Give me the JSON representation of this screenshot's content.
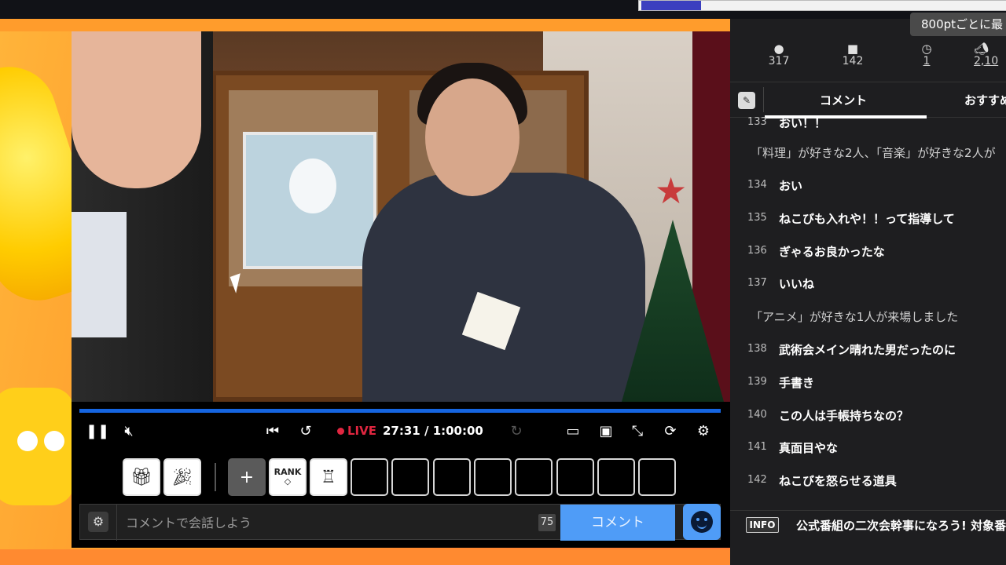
{
  "player": {
    "time_current": "27:31",
    "time_total": "1:00:00",
    "time_separator": " / ",
    "live_label": "LIVE",
    "progress": 1.0
  },
  "toolbar": {
    "rank_label": "RANK"
  },
  "comment_bar": {
    "placeholder": "コメントで会話しよう",
    "char_count": "75",
    "submit_label": "コメント"
  },
  "tooltip": "800ptごとに最",
  "stats": [
    {
      "icon": "viewers-icon",
      "value": "317"
    },
    {
      "icon": "comments-icon",
      "value": "142"
    },
    {
      "icon": "clock-icon",
      "value": "1"
    },
    {
      "icon": "ad-icon",
      "value": "2,10"
    }
  ],
  "tabs": {
    "comments": "コメント",
    "recommended": "おすすめ"
  },
  "comments": [
    {
      "num": "133",
      "text": "おい！！"
    },
    {
      "num": "",
      "text": "「料理」が好きな2人、「音楽」が好きな2人が"
    },
    {
      "num": "134",
      "text": "おい"
    },
    {
      "num": "135",
      "text": "ねこびも入れや！！って指導して"
    },
    {
      "num": "136",
      "text": "ぎゃるお良かったな"
    },
    {
      "num": "137",
      "text": "いいね"
    },
    {
      "num": "",
      "text": "「アニメ」が好きな1人が来場しました"
    },
    {
      "num": "138",
      "text": "武術会メイン晴れた男だったのに"
    },
    {
      "num": "139",
      "text": "手書き"
    },
    {
      "num": "140",
      "text": "この人は手帳持ちなの？"
    },
    {
      "num": "141",
      "text": "真面目やな"
    },
    {
      "num": "142",
      "text": "ねこびを怒らせる道具"
    }
  ],
  "info": {
    "badge": "INFO",
    "message": "公式番組の二次会幹事になろう! 対象番"
  },
  "colors": {
    "accent_blue": "#4f9cf7",
    "live_red": "#e02640",
    "progress_blue": "#1565e0"
  }
}
